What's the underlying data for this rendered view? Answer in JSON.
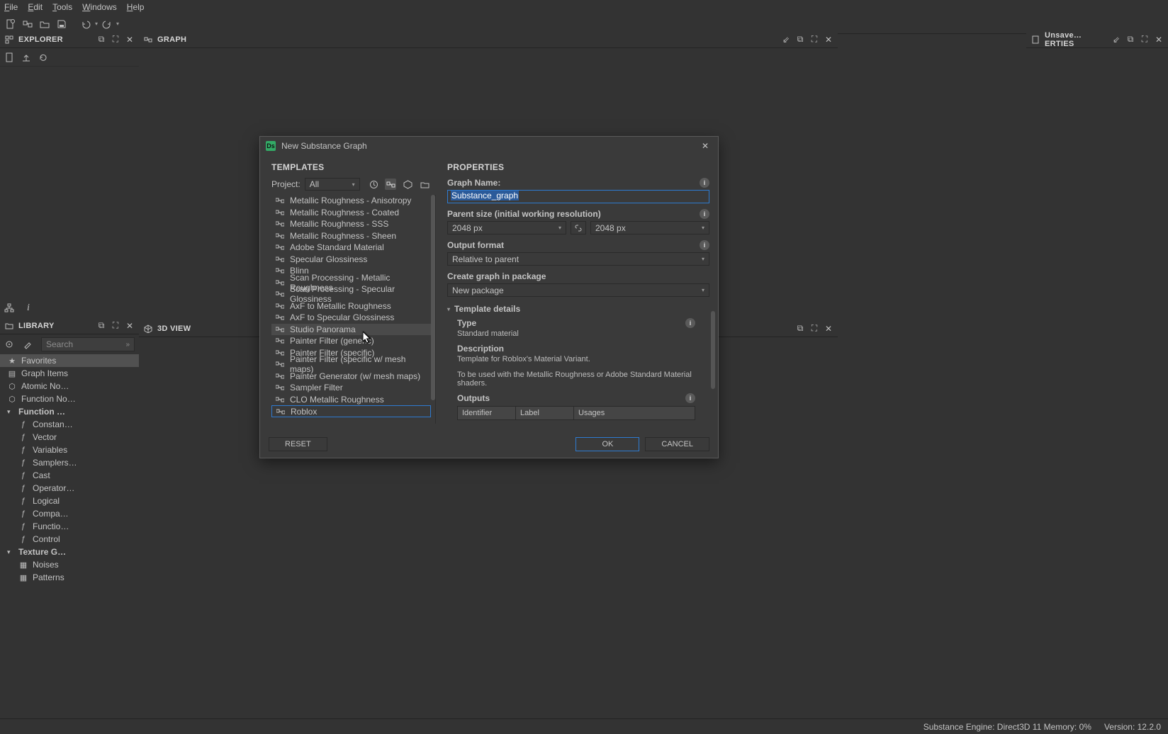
{
  "menu": {
    "file": "File",
    "edit": "Edit",
    "tools": "Tools",
    "windows": "Windows",
    "help": "Help"
  },
  "panels": {
    "explorer": "EXPLORER",
    "graph": "GRAPH",
    "library": "LIBRARY",
    "view3d": "3D VIEW",
    "properties": "Unsave…ERTIES"
  },
  "library": {
    "search_placeholder": "Search",
    "favorites": "Favorites",
    "items": [
      "Graph Items",
      "Atomic No…",
      "Function No…",
      "Function …",
      "Constan…",
      "Vector",
      "Variables",
      "Samplers…",
      "Cast",
      "Operator…",
      "Logical",
      "Compa…",
      "Functio…",
      "Control",
      "Texture G…",
      "Noises",
      "Patterns"
    ]
  },
  "dialog": {
    "title": "New Substance Graph",
    "templates_hdr": "TEMPLATES",
    "properties_hdr": "PROPERTIES",
    "project_label": "Project:",
    "project_value": "All",
    "templates": [
      "Metallic Roughness - Anisotropy",
      "Metallic Roughness - Coated",
      "Metallic Roughness - SSS",
      "Metallic Roughness - Sheen",
      "Adobe Standard Material",
      "Specular Glossiness",
      "Blinn",
      "Scan Processing - Metallic Roughness",
      "Scan Processing - Specular Glossiness",
      "AxF to Metallic Roughness",
      "AxF to Specular Glossiness",
      "Studio Panorama",
      "Painter Filter (generic)",
      "Painter Filter (specific)",
      "Painter Filter (specific w/ mesh maps)",
      "Painter Generator (w/ mesh maps)",
      "Sampler Filter",
      "CLO Metallic Roughness",
      "Roblox"
    ],
    "hover_index": 11,
    "selected_index": 18,
    "graph_name_lbl": "Graph Name:",
    "graph_name_val": "Substance_graph",
    "parent_size_lbl": "Parent size (initial working resolution)",
    "size_w": "2048 px",
    "size_h": "2048 px",
    "output_format_lbl": "Output format",
    "output_format_val": "Relative to parent",
    "create_pkg_lbl": "Create graph in package",
    "create_pkg_val": "New package",
    "tmpl_details": "Template details",
    "type_lbl": "Type",
    "type_val": "Standard material",
    "desc_lbl": "Description",
    "desc_val1": "Template for Roblox's Material Variant.",
    "desc_val2": "To be used with the Metallic Roughness or Adobe Standard Material shaders.",
    "outputs_lbl": "Outputs",
    "out_cols": {
      "id": "Identifier",
      "label": "Label",
      "usages": "Usages"
    },
    "reset": "RESET",
    "ok": "OK",
    "cancel": "CANCEL"
  },
  "status": {
    "engine": "Substance Engine: Direct3D 11  Memory: 0%",
    "version": "Version: 12.2.0"
  }
}
